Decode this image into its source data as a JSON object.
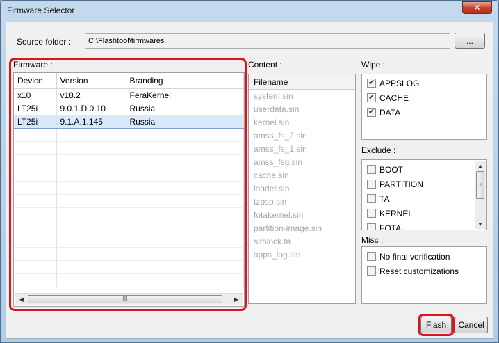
{
  "window": {
    "title": "Firmware Selector",
    "close_label": "✕"
  },
  "source": {
    "label": "Source folder :",
    "path": "C:\\Flashtool\\firmwares",
    "browse_label": "..."
  },
  "firmware": {
    "label": "Firmware :",
    "columns": [
      "Device",
      "Version",
      "Branding"
    ],
    "rows": [
      {
        "device": "x10",
        "version": "v18.2",
        "branding": "FeraKernel"
      },
      {
        "device": "LT25i",
        "version": "9.0.1.D.0.10",
        "branding": "Russia"
      },
      {
        "device": "LT25i",
        "version": "9.1.A.1.145",
        "branding": "Russia"
      }
    ],
    "selected_row": 2,
    "scroll_thumb_label": "III"
  },
  "content": {
    "label": "Content :",
    "header": "Filename",
    "files": [
      "system.sin",
      "userdata.sin",
      "kernel.sin",
      "amss_fs_2.sin",
      "amss_fs_1.sin",
      "amss_fsg.sin",
      "cache.sin",
      "loader.sin",
      "tzbsp.sin",
      "fotakernel.sin",
      "partition-image.sin",
      "simlock.ta",
      "apps_log.sin"
    ]
  },
  "wipe": {
    "label": "Wipe :",
    "items": [
      {
        "label": "APPSLOG",
        "checked": true
      },
      {
        "label": "CACHE",
        "checked": true
      },
      {
        "label": "DATA",
        "checked": true
      }
    ]
  },
  "exclude": {
    "label": "Exclude :",
    "items": [
      {
        "label": "BOOT",
        "checked": false
      },
      {
        "label": "PARTITION",
        "checked": false
      },
      {
        "label": "TA",
        "checked": false
      },
      {
        "label": "KERNEL",
        "checked": false
      },
      {
        "label": "FOTA",
        "checked": false
      }
    ]
  },
  "misc": {
    "label": "Misc :",
    "items": [
      {
        "label": "No final verification",
        "checked": false
      },
      {
        "label": "Reset customizations",
        "checked": false
      }
    ]
  },
  "actions": {
    "flash_label": "Flash",
    "cancel_label": "Cancel"
  },
  "colors": {
    "highlight_outline": "#d9151e",
    "selected_row": "#d9e8fb"
  }
}
